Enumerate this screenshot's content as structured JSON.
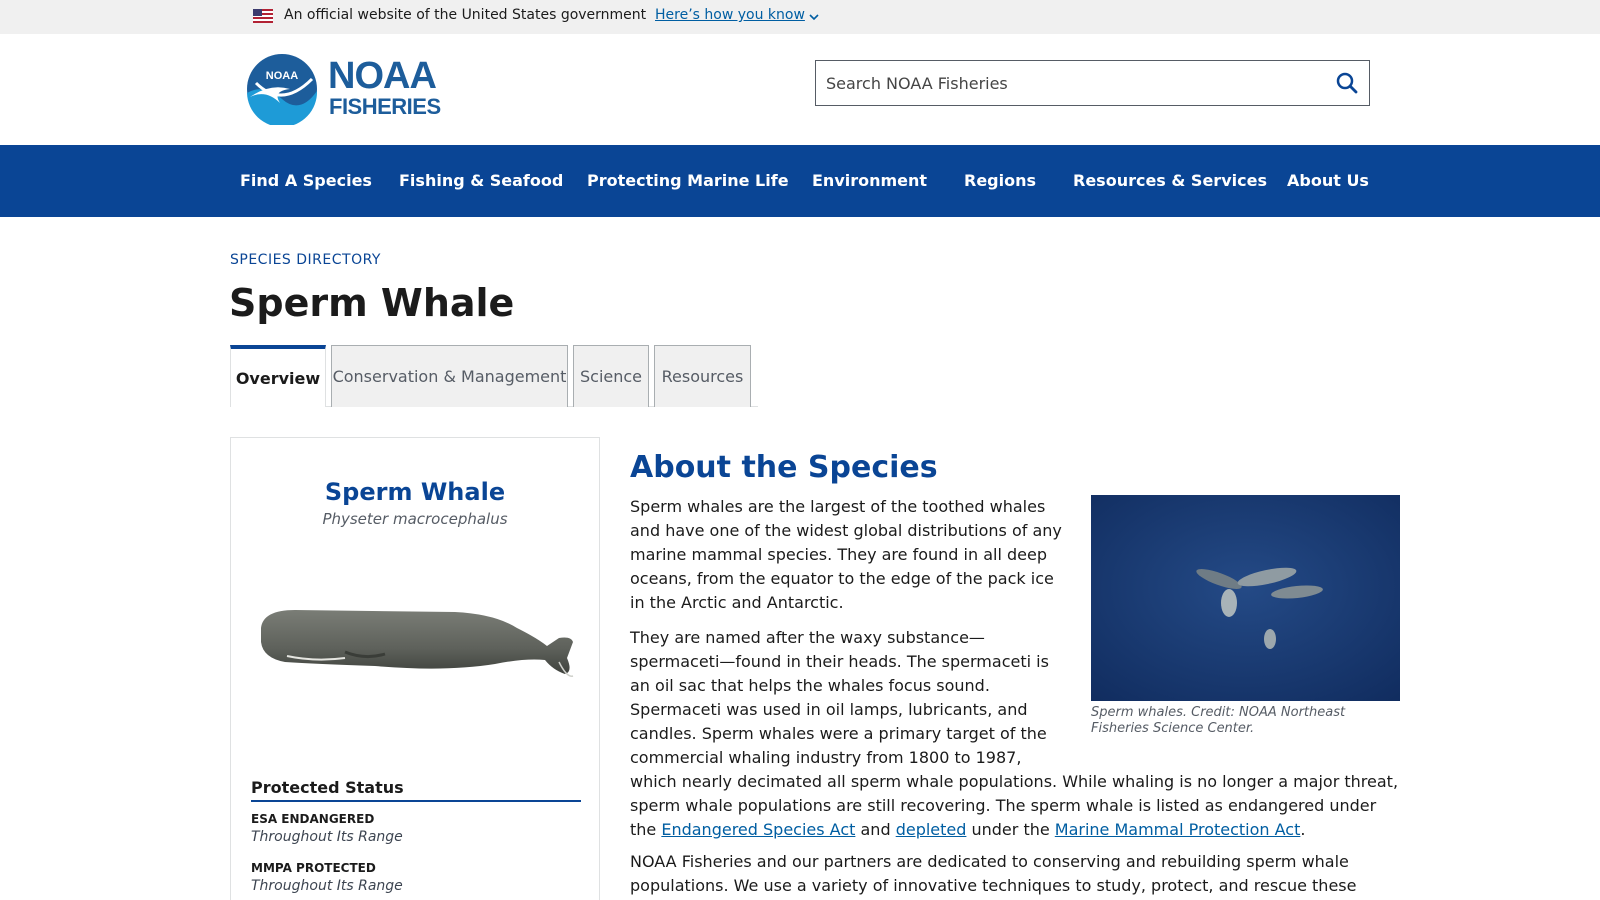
{
  "gov_banner": {
    "text": "An official website of the United States government",
    "link": "Here’s how you know"
  },
  "header": {
    "logo_noaa": "NOAA",
    "logo_fisheries": "FISHERIES",
    "logo_emblem_text": "NOAA",
    "search_placeholder": "Search NOAA Fisheries"
  },
  "nav": {
    "items": [
      "Find A Species",
      "Fishing & Seafood",
      "Protecting Marine Life",
      "Environment",
      "Regions",
      "Resources & Services",
      "About Us"
    ]
  },
  "page": {
    "breadcrumb": "SPECIES DIRECTORY",
    "title": "Sperm Whale"
  },
  "tabs": [
    "Overview",
    "Conservation & Management",
    "Science",
    "Resources"
  ],
  "card": {
    "name": "Sperm Whale",
    "scientific_name": "Physeter macrocephalus",
    "status_heading": "Protected Status",
    "statuses": [
      {
        "label": "ESA ENDANGERED",
        "value": "Throughout Its Range"
      },
      {
        "label": "MMPA PROTECTED",
        "value": "Throughout Its Range"
      }
    ]
  },
  "content": {
    "section_title": "About the Species",
    "photo_caption": "Sperm whales. Credit: NOAA Northeast Fisheries Science Center.",
    "p1": "Sperm whales are the largest of the toothed whales and have one of the widest global distributions of any marine mammal species. They are found in all deep oceans, from the equator to the edge of the pack ice in the Arctic and Antarctic.",
    "p2_a": "They are named after the waxy substance—spermaceti—found in their heads. The spermaceti is an oil sac that helps the whales focus sound. Spermaceti was used in oil lamps, lubricants, and candles. Sperm whales were a primary target of the commercial whaling industry from 1800 to 1987, which nearly decimated all sperm whale populations. While whaling is no longer a major threat, sperm whale populations are still recovering. The sperm whale is listed as endangered under the ",
    "p2_link1": "Endangered Species Act",
    "p2_b": " and ",
    "p2_link2": "depleted",
    "p2_c": " under the ",
    "p2_link3": "Marine Mammal Protection Act",
    "p2_d": ".",
    "p3": "NOAA Fisheries and our partners are dedicated to conserving and rebuilding sperm whale populations. We use a variety of innovative techniques to study, protect, and rescue these endangered whales. We"
  }
}
